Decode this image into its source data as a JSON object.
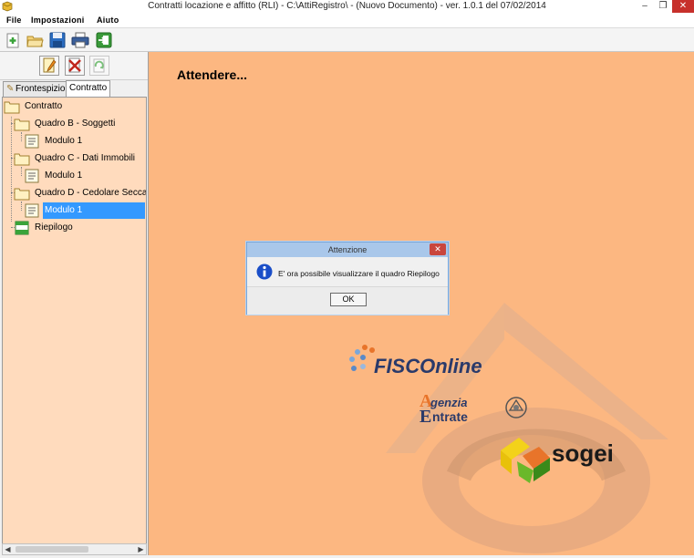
{
  "window": {
    "title": "Contratti locazione e affitto (RLI) - C:\\AttiRegistro\\ - (Nuovo Documento)  -  ver. 1.0.1 del 07/02/2014",
    "minimize": "–",
    "maximize": "❐",
    "close": "✕"
  },
  "menu": {
    "file": "File",
    "impostazioni": "Impostazioni",
    "aiuto": "Aiuto"
  },
  "toolbar": {
    "icons": [
      "new-icon",
      "open-folder-icon",
      "save-icon",
      "print-icon",
      "exit-icon"
    ]
  },
  "left_toolbar": {
    "icons": [
      "edit-document-icon",
      "delete-document-icon",
      "refresh-icon"
    ]
  },
  "tabs": {
    "frontespizio": "Frontespizio",
    "contratto": "Contratto",
    "active": "Contratto"
  },
  "tree": {
    "root": "Contratto",
    "quadro_b": "Quadro B - Soggetti",
    "quadro_b_mod": "Modulo 1",
    "quadro_c": "Quadro C - Dati Immobili",
    "quadro_c_mod": "Modulo 1",
    "quadro_d": "Quadro D - Cedolare Secca",
    "quadro_d_mod": "Modulo 1",
    "riepilogo": "Riepilogo",
    "selected": "Quadro D - Cedolare Secca / Modulo 1"
  },
  "main": {
    "status": "Attendere..."
  },
  "dialog": {
    "title": "Attenzione",
    "message": "E' ora possibile visualizzare il quadro Riepilogo",
    "ok": "OK",
    "close": "✕"
  },
  "logos": {
    "fisco": "FISCOnline",
    "agenzia_line1": "genzia",
    "agenzia_line2": "ntrate",
    "sogei": "sogei"
  },
  "colors": {
    "tree_bg": "#ffdbbd",
    "main_bg": "#fcb781",
    "selection": "#3399ff",
    "dialog_title_bg": "#a9c7ea",
    "close_red": "#c7302b"
  }
}
